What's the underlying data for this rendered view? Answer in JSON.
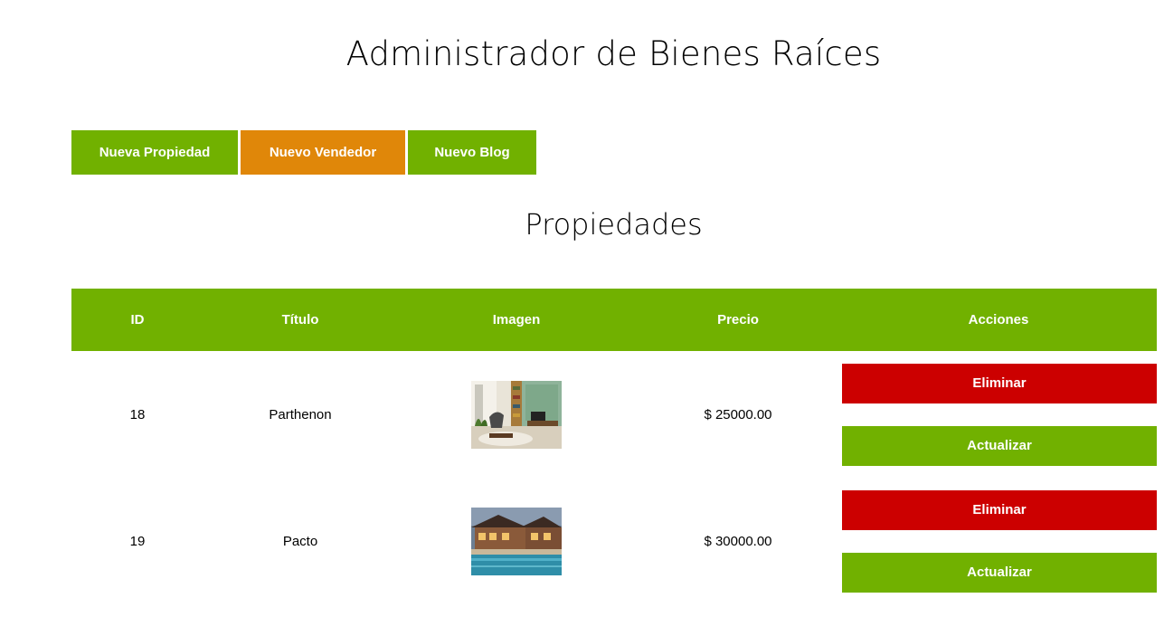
{
  "header": {
    "title": "Administrador de Bienes Raíces"
  },
  "toolbar": {
    "new_property_label": "Nueva Propiedad",
    "new_seller_label": "Nuevo Vendedor",
    "new_blog_label": "Nuevo Blog"
  },
  "section": {
    "title": "Propiedades"
  },
  "table": {
    "columns": [
      "ID",
      "Título",
      "Imagen",
      "Precio",
      "Acciones"
    ],
    "rows": [
      {
        "id": "18",
        "title": "Parthenon",
        "image": "living-room-photo",
        "price": "$ 25000.00",
        "delete_label": "Eliminar",
        "update_label": "Actualizar"
      },
      {
        "id": "19",
        "title": "Pacto",
        "image": "house-pool-photo",
        "price": "$ 30000.00",
        "delete_label": "Eliminar",
        "update_label": "Actualizar"
      }
    ]
  },
  "colors": {
    "green": "#71b100",
    "orange": "#e08709",
    "red": "#cc0000"
  }
}
